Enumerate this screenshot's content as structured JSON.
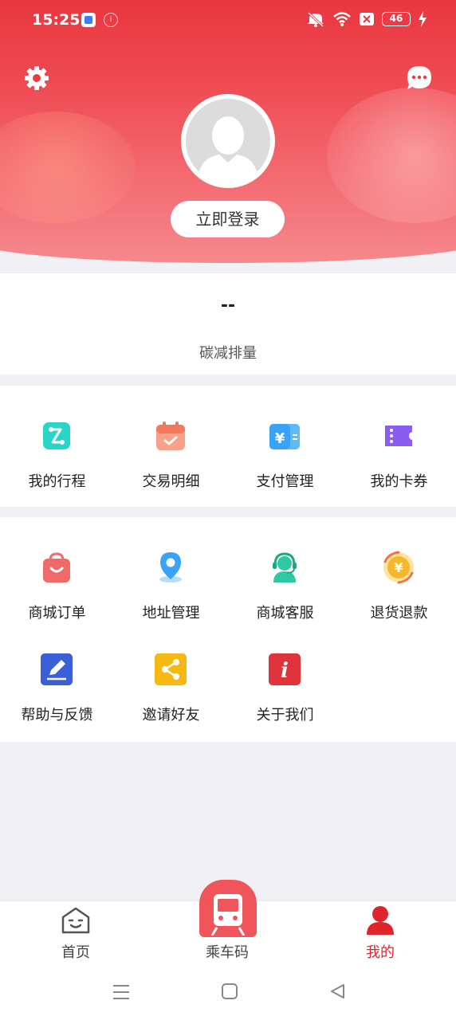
{
  "status_bar": {
    "time": "15:25",
    "battery": "46"
  },
  "header": {
    "login_label": "立即登录"
  },
  "carbon": {
    "value": "--",
    "label": "碳减排量"
  },
  "services_primary": [
    {
      "label": "我的行程",
      "icon": "trip-icon",
      "color": "#2ad4c8"
    },
    {
      "label": "交易明细",
      "icon": "calendar-check-icon",
      "color": "#f4785c"
    },
    {
      "label": "支付管理",
      "icon": "yuan-card-icon",
      "color": "#3aa3f5"
    },
    {
      "label": "我的卡券",
      "icon": "ticket-icon",
      "color": "#8a5cf0"
    }
  ],
  "services_secondary": [
    {
      "label": "商城订单",
      "icon": "shopping-bag-icon",
      "color": "#f06a6a"
    },
    {
      "label": "地址管理",
      "icon": "location-pin-icon",
      "color": "#3aa3f5"
    },
    {
      "label": "商城客服",
      "icon": "customer-service-icon",
      "color": "#2ec9a2"
    },
    {
      "label": "退货退款",
      "icon": "refund-icon",
      "color": "#f6b82a"
    },
    {
      "label": "帮助与反馈",
      "icon": "edit-feedback-icon",
      "color": "#3a5fd6"
    },
    {
      "label": "邀请好友",
      "icon": "share-icon",
      "color": "#f6b812"
    },
    {
      "label": "关于我们",
      "icon": "info-icon",
      "color": "#e0343c"
    }
  ],
  "bottom_nav": {
    "home": "首页",
    "ride_code": "乘车码",
    "mine": "我的",
    "active_color": "#e0242c"
  }
}
